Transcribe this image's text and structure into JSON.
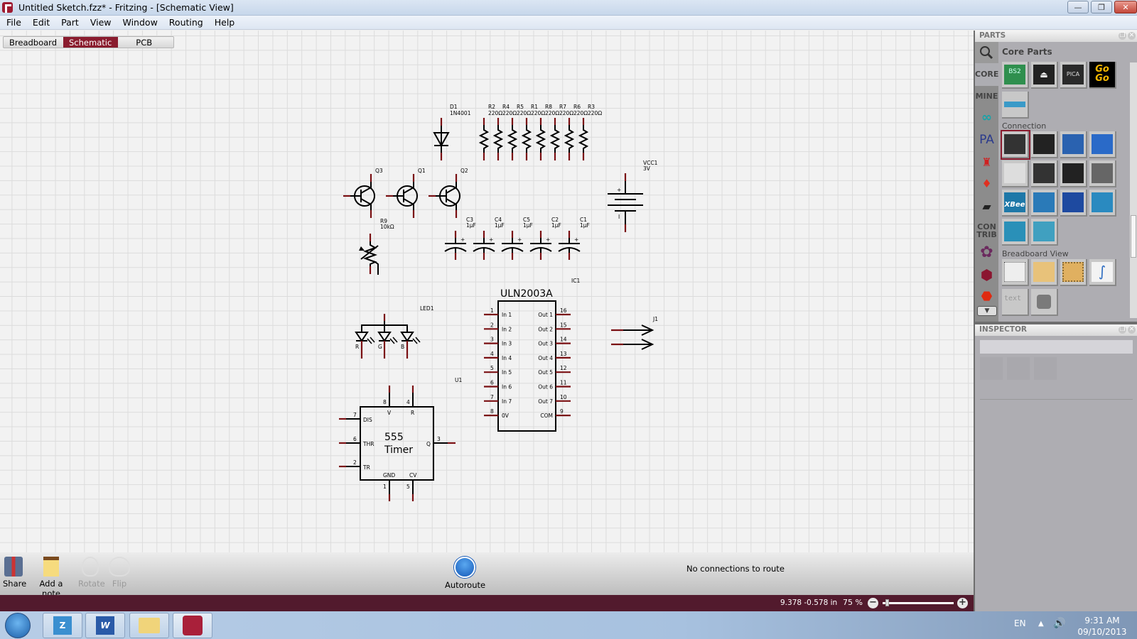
{
  "window": {
    "title": "Untitled Sketch.fzz* - Fritzing - [Schematic View]",
    "buttons": {
      "minimize": "—",
      "maximize": "❐",
      "close": "✕"
    }
  },
  "menu": [
    "File",
    "Edit",
    "Part",
    "View",
    "Window",
    "Routing",
    "Help"
  ],
  "view_tabs": [
    {
      "label": "Breadboard",
      "active": false
    },
    {
      "label": "Schematic",
      "active": true
    },
    {
      "label": "PCB",
      "active": false
    }
  ],
  "schematic": {
    "diode": {
      "ref": "D1",
      "value": "1N4001"
    },
    "resistors": [
      {
        "ref": "R2",
        "value": "220Ω"
      },
      {
        "ref": "R4",
        "value": "220Ω"
      },
      {
        "ref": "R5",
        "value": "220Ω"
      },
      {
        "ref": "R1",
        "value": "220Ω"
      },
      {
        "ref": "R8",
        "value": "220Ω"
      },
      {
        "ref": "R7",
        "value": "220Ω"
      },
      {
        "ref": "R6",
        "value": "220Ω"
      },
      {
        "ref": "R3",
        "value": "220Ω"
      }
    ],
    "transistors": [
      "Q3",
      "Q1",
      "Q2"
    ],
    "potentiometer": {
      "ref": "R9",
      "value": "10kΩ"
    },
    "capacitors": [
      {
        "ref": "C3",
        "value": "1µF"
      },
      {
        "ref": "C4",
        "value": "1µF"
      },
      {
        "ref": "C5",
        "value": "1µF"
      },
      {
        "ref": "C2",
        "value": "1µF"
      },
      {
        "ref": "C1",
        "value": "1µF"
      }
    ],
    "battery": {
      "ref": "VCC1",
      "value": "3V",
      "plus": "+",
      "minus": "I"
    },
    "rgb_led": {
      "ref": "LED1",
      "channels": [
        "R",
        "G",
        "B"
      ]
    },
    "uln2003": {
      "ref": "IC1",
      "title": "ULN2003A",
      "left_pins": [
        {
          "num": "1",
          "name": "In 1"
        },
        {
          "num": "2",
          "name": "In 2"
        },
        {
          "num": "3",
          "name": "In 3"
        },
        {
          "num": "4",
          "name": "In 4"
        },
        {
          "num": "5",
          "name": "In 5"
        },
        {
          "num": "6",
          "name": "In 6"
        },
        {
          "num": "7",
          "name": "In 7"
        },
        {
          "num": "8",
          "name": "0V"
        }
      ],
      "right_pins": [
        {
          "num": "16",
          "name": "Out 1"
        },
        {
          "num": "15",
          "name": "Out 2"
        },
        {
          "num": "14",
          "name": "Out 3"
        },
        {
          "num": "13",
          "name": "Out 4"
        },
        {
          "num": "12",
          "name": "Out 5"
        },
        {
          "num": "11",
          "name": "Out 6"
        },
        {
          "num": "10",
          "name": "Out 7"
        },
        {
          "num": "9",
          "name": "COM"
        }
      ]
    },
    "connector": {
      "ref": "J1"
    },
    "timer555": {
      "ref": "U1",
      "title_line1": "555",
      "title_line2": "Timer",
      "pins": {
        "V": "8",
        "R": "4",
        "DIS": "7",
        "THR": "6",
        "TR": "2",
        "Q": "3",
        "GND": "1",
        "CV": "5"
      },
      "pin_names": {
        "V": "V",
        "R": "R",
        "DIS": "DIS",
        "THR": "THR",
        "TR": "TR",
        "Q": "Q",
        "GND": "GND",
        "CV": "CV"
      }
    }
  },
  "toolbar": {
    "share": "Share",
    "add_note": "Add a note",
    "rotate": "Rotate",
    "flip": "Flip",
    "autoroute": "Autoroute",
    "status": "No connections to route"
  },
  "statusbar": {
    "coordinates": "9.378 -0.578 in",
    "zoom": "75 %",
    "zoom_level_fraction": 0.04
  },
  "parts_panel": {
    "header": "PARTS",
    "bin_title": "Core Parts",
    "bin_tabs": [
      "CORE",
      "MINE",
      "arduino-icon",
      "PA",
      "fab-icon",
      "sparkfun-icon",
      "snootlab-icon",
      "CON TRIB",
      "flower-icon",
      "hexagon-icon",
      "stop-icon"
    ],
    "contrib_label": "CON\nTRIB",
    "sections": [
      "Connection",
      "Breadboard View"
    ],
    "core_parts": [
      "BS2",
      "propeller",
      "PICA",
      "GoGo",
      "shield-strip"
    ],
    "connection_parts": [
      "power-jack",
      "header",
      "screw-terminal",
      "serial-port",
      "usb",
      "mini-din",
      "rj45",
      "ethernet",
      "xbee",
      "arduino-ethernet",
      "microcontroller",
      "board-blue",
      "perfboard",
      "stripboard-teal"
    ],
    "gogo_text": [
      "Go",
      "Go"
    ],
    "bs2_text": "BS2",
    "pica_text": "PICA",
    "xbee_text": "XBee",
    "text_part": "text"
  },
  "inspector": {
    "header": "INSPECTOR"
  },
  "taskbar": {
    "apps": [
      "start",
      "zim",
      "word",
      "explorer",
      "fritzing"
    ],
    "lang": "EN",
    "time": "9:31 AM",
    "date": "09/10/2013"
  },
  "colors": {
    "accent": "#8a1c2e",
    "statusbar": "#521a2d",
    "pin": "#7a0f12"
  }
}
